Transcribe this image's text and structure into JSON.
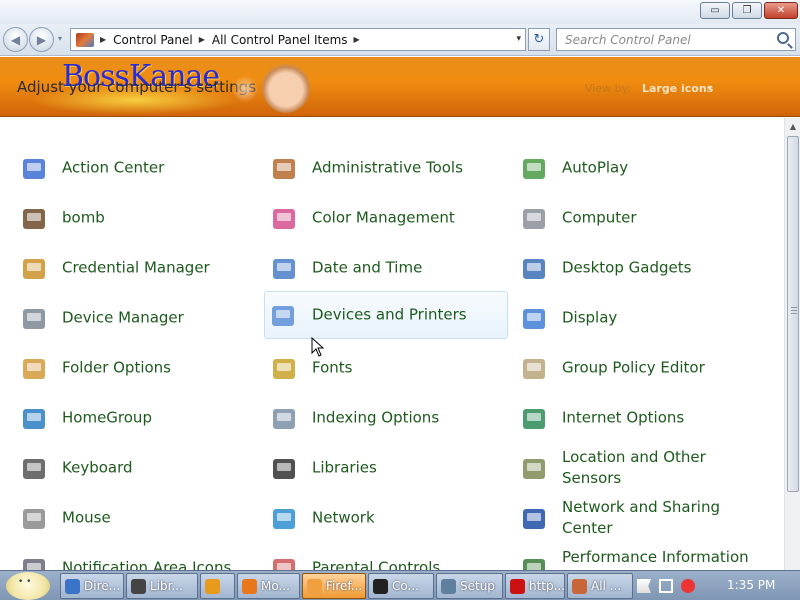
{
  "window": {
    "minimize_glyph": "▭",
    "maximize_glyph": "❐",
    "close_glyph": "✕"
  },
  "nav": {
    "back_glyph": "◀",
    "forward_glyph": "▶",
    "history_glyph": "▾",
    "breadcrumbs": [
      "Control Panel",
      "All Control Panel Items"
    ],
    "address_dropdown_glyph": "▾",
    "refresh_glyph": "↻",
    "search_placeholder": "Search Control Panel"
  },
  "header": {
    "logo_text": "BossKanae",
    "title": "Adjust your computer's settings",
    "view_by_label": "View by:",
    "view_by_value": "Large icons",
    "view_by_caret": "▾"
  },
  "items": [
    {
      "label": "Action Center",
      "icon": "action-center-flag-icon"
    },
    {
      "label": "Administrative Tools",
      "icon": "administrative-tools-icon"
    },
    {
      "label": "AutoPlay",
      "icon": "autoplay-icon"
    },
    {
      "label": "bomb",
      "icon": "bomb-icon"
    },
    {
      "label": "Color Management",
      "icon": "color-management-icon"
    },
    {
      "label": "Computer",
      "icon": "computer-icon"
    },
    {
      "label": "Credential Manager",
      "icon": "credential-manager-icon"
    },
    {
      "label": "Date and Time",
      "icon": "date-time-icon"
    },
    {
      "label": "Desktop Gadgets",
      "icon": "desktop-gadgets-icon"
    },
    {
      "label": "Device Manager",
      "icon": "device-manager-icon"
    },
    {
      "label": "Devices and Printers",
      "icon": "printer-icon"
    },
    {
      "label": "Display",
      "icon": "display-monitor-icon"
    },
    {
      "label": "Folder Options",
      "icon": "folder-options-icon"
    },
    {
      "label": "Fonts",
      "icon": "fonts-icon"
    },
    {
      "label": "Group Policy Editor",
      "icon": "group-policy-icon"
    },
    {
      "label": "HomeGroup",
      "icon": "homegroup-icon"
    },
    {
      "label": "Indexing Options",
      "icon": "indexing-options-icon"
    },
    {
      "label": "Internet Options",
      "icon": "internet-options-icon"
    },
    {
      "label": "Keyboard",
      "icon": "keyboard-icon"
    },
    {
      "label": "Libraries",
      "icon": "libraries-icon"
    },
    {
      "label": "Location and Other Sensors",
      "icon": "location-sensors-icon"
    },
    {
      "label": "Mouse",
      "icon": "mouse-icon"
    },
    {
      "label": "Network",
      "icon": "network-icon"
    },
    {
      "label": "Network and Sharing Center",
      "icon": "network-sharing-icon"
    },
    {
      "label": "Notification Area Icons",
      "icon": "notification-area-icon"
    },
    {
      "label": "Parental Controls",
      "icon": "parental-controls-icon"
    },
    {
      "label": "Performance Information and Tools",
      "icon": "performance-icon"
    }
  ],
  "taskbar": {
    "tasks": [
      {
        "label": "Dire...",
        "icon": "explorer-ie-icon",
        "active": false
      },
      {
        "label": "Libr...",
        "icon": "libraries-task-icon",
        "active": false
      },
      {
        "label": "",
        "icon": "media-player-icon",
        "active": false
      },
      {
        "label": "Mo...",
        "icon": "firefox-icon",
        "active": false
      },
      {
        "label": "Firef...",
        "icon": "firefox-window-icon",
        "active": true
      },
      {
        "label": "Co...",
        "icon": "cmd-icon",
        "active": false
      },
      {
        "label": "Setup",
        "icon": "setup-icon",
        "active": false
      },
      {
        "label": "http...",
        "icon": "opera-icon",
        "active": false
      },
      {
        "label": "All ...",
        "icon": "control-panel-icon",
        "active": false
      }
    ],
    "clock": "1:35 PM"
  },
  "colors": {
    "header_orange": "#f08d10",
    "item_text_green": "#1e5a1e",
    "logo_blue": "#2b2bd6"
  }
}
